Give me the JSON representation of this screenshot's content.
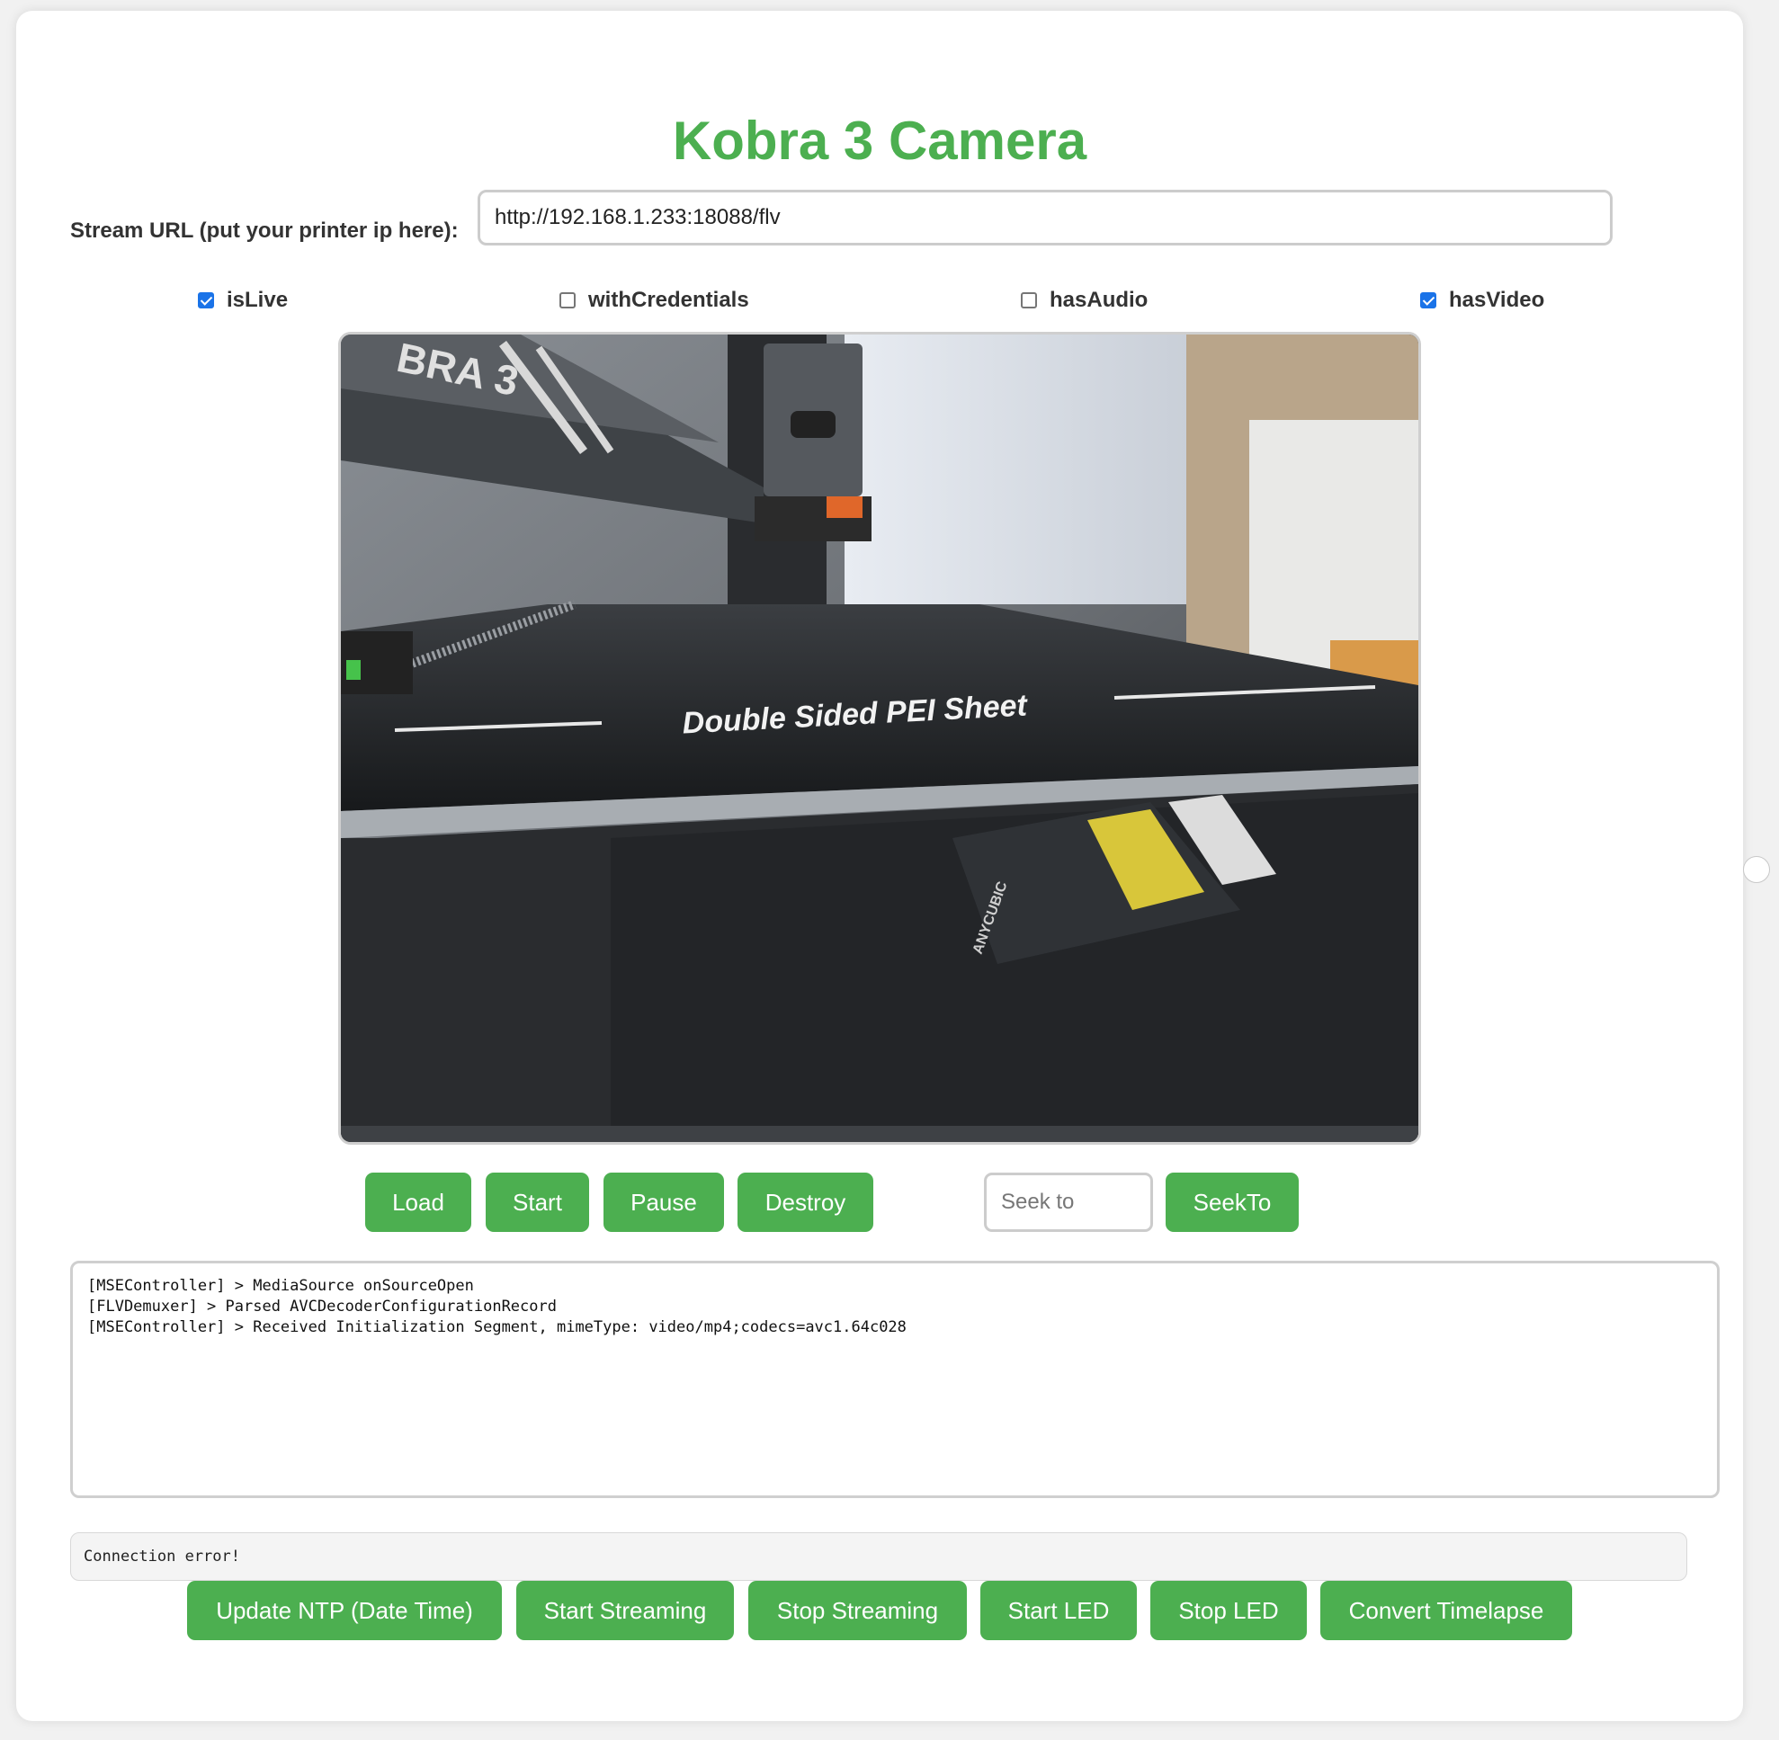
{
  "page": {
    "title": "Kobra 3 Camera"
  },
  "stream": {
    "label": "Stream URL (put your printer ip here):",
    "url": "http://192.168.1.233:18088/flv"
  },
  "options": [
    {
      "label": "isLive",
      "checked": true
    },
    {
      "label": "withCredentials",
      "checked": false
    },
    {
      "label": "hasAudio",
      "checked": false
    },
    {
      "label": "hasVideo",
      "checked": true
    }
  ],
  "video": {
    "overlay_text": "Double Sided PEI Sheet",
    "brand_text": "ANYCUBIC",
    "frame_text": "BRA 3"
  },
  "controls": {
    "load": "Load",
    "start": "Start",
    "pause": "Pause",
    "destroy": "Destroy",
    "seek_placeholder": "Seek to",
    "seekto": "SeekTo"
  },
  "log": {
    "lines": [
      "[MSEController] > MediaSource onSourceOpen",
      "[FLVDemuxer] > Parsed AVCDecoderConfigurationRecord",
      "[MSEController] > Received Initialization Segment, mimeType: video/mp4;codecs=avc1.64c028"
    ]
  },
  "status": {
    "text": "Connection error!"
  },
  "actions": {
    "update_ntp": "Update NTP (Date Time)",
    "start_streaming": "Start Streaming",
    "stop_streaming": "Stop Streaming",
    "start_led": "Start LED",
    "stop_led": "Stop LED",
    "convert_timelapse": "Convert Timelapse"
  },
  "colors": {
    "accent": "#4caf50",
    "checkbox": "#1a73e8"
  }
}
